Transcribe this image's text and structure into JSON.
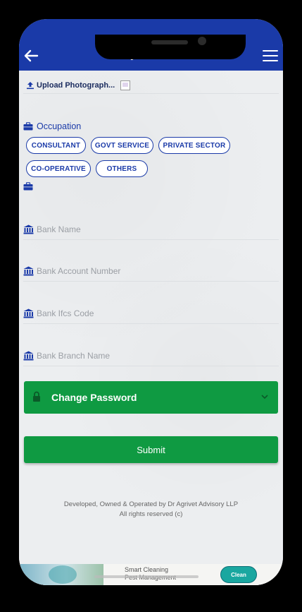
{
  "header": {
    "title": "My Profile",
    "back_icon": "arrow-left-icon",
    "menu_icon": "hamburger-menu-icon"
  },
  "upload": {
    "label": "Upload Photograph..."
  },
  "occupation": {
    "label": "Occupation",
    "options": [
      "CONSULTANT",
      "GOVT SERVICE",
      "PRIVATE SECTOR",
      "CO-OPERATIVE",
      "OTHERS"
    ]
  },
  "fields": {
    "bank_name": {
      "placeholder": "Bank Name",
      "value": ""
    },
    "bank_account": {
      "placeholder": "Bank Account Number",
      "value": ""
    },
    "bank_ifsc": {
      "placeholder": "Bank Ifcs Code",
      "value": ""
    },
    "bank_branch": {
      "placeholder": "Bank Branch Name",
      "value": ""
    }
  },
  "change_password": {
    "label": "Change Password"
  },
  "submit": {
    "label": "Submit"
  },
  "footer": {
    "line1": "Developed, Owned & Operated by Dr Agrivet Advisory LLP",
    "line2": "All rights reserved (c)"
  },
  "banner": {
    "line1": "Smart Cleaning",
    "line2": "Pest Management",
    "logo": "Clean"
  },
  "colors": {
    "primary_blue": "#1a3aa8",
    "green": "#0f9a42",
    "background": "#eceef0"
  }
}
